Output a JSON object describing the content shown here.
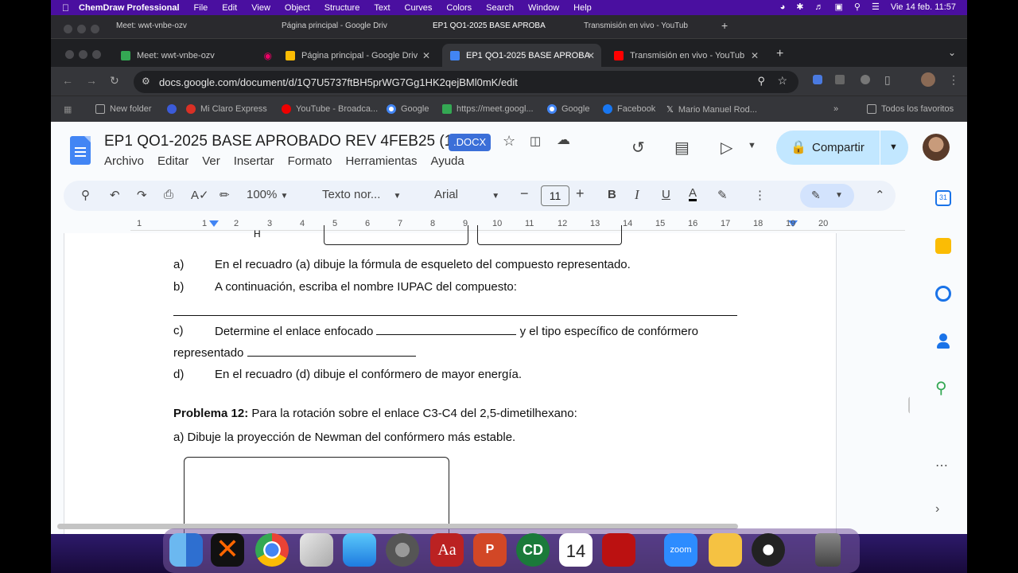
{
  "menubar": {
    "app_name": "ChemDraw Professional",
    "items": [
      "File",
      "Edit",
      "View",
      "Object",
      "Structure",
      "Text",
      "Curves",
      "Colors",
      "Search",
      "Window",
      "Help"
    ],
    "datetime": "Vie 14 feb.  11:57"
  },
  "background_window": {
    "tabs": [
      "Meet: wwt-vnbe-ozv",
      "Página principal - Google Driv",
      "EP1 QO1-2025 BASE APROBA",
      "Transmisión en vivo - YouTub"
    ]
  },
  "browser": {
    "tabs": [
      {
        "label": "Meet: wwt-vnbe-ozv",
        "icon": "google-meet-icon",
        "color": "#34a853"
      },
      {
        "label": "Página principal - Google Driv",
        "icon": "google-drive-icon",
        "color": "#fbbc04"
      },
      {
        "label": "EP1 QO1-2025 BASE APROBA",
        "icon": "google-docs-icon",
        "color": "#4285f4"
      },
      {
        "label": "Transmisión en vivo - YouTub",
        "icon": "youtube-icon",
        "color": "#ff0000"
      }
    ],
    "url": "docs.google.com/document/d/1Q7U5737ftBH5prWG7Gg1HK2qejBMl0mK/edit",
    "bookmarks": [
      {
        "label": "New folder",
        "icon": "folder-icon"
      },
      {
        "label": "Mi Claro Express",
        "icon": "claro-icon"
      },
      {
        "label": "YouTube - Broadca...",
        "icon": "youtube-icon"
      },
      {
        "label": "Google",
        "icon": "google-icon"
      },
      {
        "label": "https://meet.googl...",
        "icon": "google-meet-icon"
      },
      {
        "label": "Google",
        "icon": "google-icon"
      },
      {
        "label": "Facebook",
        "icon": "facebook-icon"
      },
      {
        "label": "Mario Manuel Rod...",
        "icon": "x-icon"
      }
    ],
    "all_bookmarks": "Todos los favoritos"
  },
  "docs": {
    "title": "EP1 QO1-2025 BASE APROBADO REV 4FEB25 (1)",
    "badge": ".DOCX",
    "menu": [
      "Archivo",
      "Editar",
      "Ver",
      "Insertar",
      "Formato",
      "Herramientas",
      "Ayuda"
    ],
    "share_label": "Compartir",
    "toolbar": {
      "zoom": "100%",
      "style": "Texto nor...",
      "font": "Arial",
      "font_size": "11"
    },
    "ruler_numbers": [
      "1",
      "1",
      "2",
      "3",
      "4",
      "5",
      "6",
      "7",
      "8",
      "9",
      "10",
      "11",
      "12",
      "13",
      "14",
      "15",
      "16",
      "17",
      "18",
      "19",
      "20"
    ],
    "content": {
      "a_label": "a)",
      "a_text": "En el recuadro (a) dibuje la fórmula de esqueleto del compuesto representado.",
      "b_label": "b)",
      "b_text": "A continuación, escriba el nombre IUPAC del compuesto:",
      "c_label": "c)",
      "c_text_1": "Determine el enlace enfocado",
      "c_text_2": "y el tipo específico de confórmero",
      "c_line2": "representado",
      "d_label": "d)",
      "d_text": "En el recuadro (d) dibuje el confórmero de mayor energía.",
      "problem_bold": "Problema 12:",
      "problem_text": " Para la rotación sobre el enlace C3-C4 del 2,5-dimetilhexano:",
      "part_a": "a) Dibuje la proyección de Newman del confórmero más estable.",
      "top_fragment": "H"
    }
  },
  "dock": {
    "calendar_day": "14",
    "apps": [
      "finder",
      "xquartz",
      "chrome",
      "launchpad",
      "mail",
      "system-settings",
      "dictionary",
      "powerpoint",
      "chemdraw",
      "calendar",
      "mendeley",
      "zoom",
      "finding-nemo",
      "obs",
      "trash"
    ]
  }
}
